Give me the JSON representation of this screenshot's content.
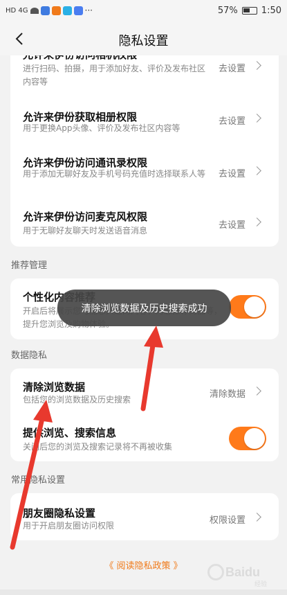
{
  "status_bar": {
    "time": "1:50",
    "battery": "57%",
    "signal_text": "HD 4G",
    "more": "···"
  },
  "nav": {
    "title": "隐私设置"
  },
  "permissions": [
    {
      "title": "允许来伊份访问相机权限",
      "desc": "进行扫码、拍摄，用于添加好友、评价及发布社区内容等",
      "action": "去设置"
    },
    {
      "title": "允许来伊份获取相册权限",
      "desc": "用于更换App头像、评价及发布社区内容等",
      "action": "去设置"
    },
    {
      "title": "允许来伊份访问通讯录权限",
      "desc": "用于添加无聊好友及手机号码充值时选择联系人等",
      "action": "去设置"
    },
    {
      "title": "允许来伊份访问麦克风权限",
      "desc": "用于无聊好友聊天时发送语音消息",
      "action": "去设置"
    }
  ],
  "sections": {
    "recommend": "推荐管理",
    "data_privacy": "数据隐私",
    "common_privacy": "常用隐私设置"
  },
  "recommend": {
    "title": "个性化内容推荐",
    "desc": "开启后将展示您可能感兴趣的内容，为您推荐商品等，提升您浏览及购物体验。",
    "enabled": true
  },
  "data_privacy": {
    "clear": {
      "title": "清除浏览数据",
      "desc": "包括您的浏览数据及历史搜索",
      "action": "清除数据"
    },
    "provide": {
      "title": "提供浏览、搜索信息",
      "desc": "关闭后您的浏览及搜索记录将不再被收集",
      "enabled": true
    }
  },
  "common": {
    "moments": {
      "title": "朋友圈隐私设置",
      "desc": "用于开启朋友圈访问权限",
      "action": "权限设置"
    }
  },
  "policy_link": "《 阅读隐私政策 》",
  "toast": "清除浏览数据及历史搜索成功",
  "watermark": {
    "text": "Baidu",
    "sub": "经验"
  },
  "colors": {
    "accent": "#ff7a1a",
    "arrow": "#e8392e",
    "link": "#f07a1a"
  }
}
